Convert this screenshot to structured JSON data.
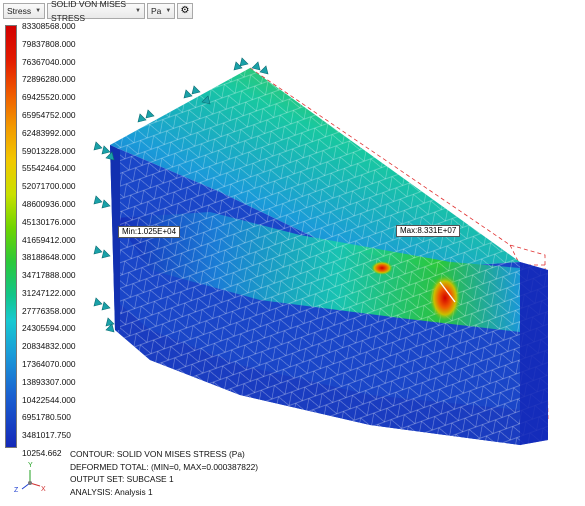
{
  "toolbar": {
    "result_type": "Stress",
    "component": "SOLID VON MISES STRESS",
    "unit": "Pa",
    "settings_icon": "gear-icon"
  },
  "legend": {
    "values": [
      "83308568.000",
      "79837808.000",
      "76367040.000",
      "72896280.000",
      "69425520.000",
      "65954752.000",
      "62483992.000",
      "59013228.000",
      "55542464.000",
      "52071700.000",
      "48600936.000",
      "45130176.000",
      "41659412.000",
      "38188648.000",
      "34717888.000",
      "31247122.000",
      "27776358.000",
      "24305594.000",
      "20834832.000",
      "17364070.000",
      "13893307.000",
      "10422544.000",
      "6951780.500",
      "3481017.750",
      "10254.662"
    ],
    "colors": {
      "max": "#d20000",
      "min": "#1428b8"
    }
  },
  "callouts": {
    "min": "Min:1.025E+04",
    "max": "Max:8.331E+07"
  },
  "info": {
    "line1": "CONTOUR: SOLID VON MISES STRESS (Pa)",
    "line2": "DEFORMED TOTAL: (MIN=0, MAX=0.000387822)",
    "line3": "OUTPUT SET: SUBCASE 1",
    "line4": "ANALYSIS: Analysis 1"
  },
  "triad": {
    "x": "X",
    "y": "Y",
    "z": "Z"
  }
}
